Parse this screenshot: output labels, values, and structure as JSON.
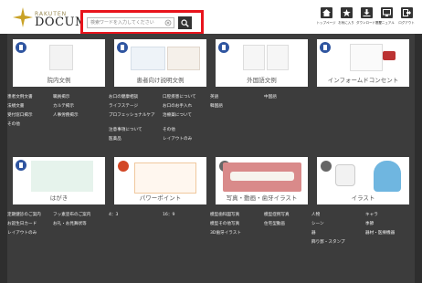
{
  "header": {
    "brand_small": "RAKUTEN",
    "logo_text": "DOCUMENT",
    "search_placeholder": "検索ワードを入力してください",
    "nav": [
      {
        "label": "トップページ",
        "icon": "home-icon"
      },
      {
        "label": "お気に入り",
        "icon": "star-icon"
      },
      {
        "label": "ダウンロード履歴",
        "icon": "download-icon"
      },
      {
        "label": "マニュアル",
        "icon": "monitor-icon"
      },
      {
        "label": "ログアウト",
        "icon": "logout-icon"
      }
    ]
  },
  "categories": [
    {
      "title": "院内文例",
      "links": [
        "患者文例文書",
        "職員掲示",
        "法規文書",
        "カルテ掲示",
        "受付窓口掲示",
        "人事労務掲示",
        "その他"
      ]
    },
    {
      "title": "患者向け説明文例",
      "links": [
        "お口の健康相談",
        "口腔疾患について",
        "ライフステージ",
        "お口のお手入れ",
        "プロフェッショナルケア",
        "治療薬について",
        "注意事項について",
        "その他",
        "医薬品",
        "レイアウトのみ"
      ]
    },
    {
      "title": "外国語文例",
      "links": [
        "英語",
        "中国語",
        "韓国語"
      ]
    },
    {
      "title": "インフォームドコンセント",
      "links": []
    },
    {
      "title": "はがき",
      "links": [
        "定期健診のご案内",
        "フッ素塗布のご案内",
        "お誕生日カード",
        "お礼・お見舞状等",
        "レイアウトのみ"
      ]
    },
    {
      "title": "パワーポイント",
      "links": [
        "4：3",
        "16：9"
      ]
    },
    {
      "title": "写真・動画・歯牙イラスト",
      "links": [
        "模型歯科図写真",
        "模型症例写真",
        "模型その他写真",
        "住宅型動画",
        "3D歯牙イラスト"
      ]
    },
    {
      "title": "イラスト",
      "links": [
        "人物",
        "キャラ",
        "シーン",
        "季節",
        "器",
        "器材・医療機器",
        "飾り罫・スタンプ"
      ]
    }
  ],
  "colors": {
    "highlight": "#e8141c",
    "badge": "#2f55a0",
    "bg": "#3c3c3c"
  }
}
